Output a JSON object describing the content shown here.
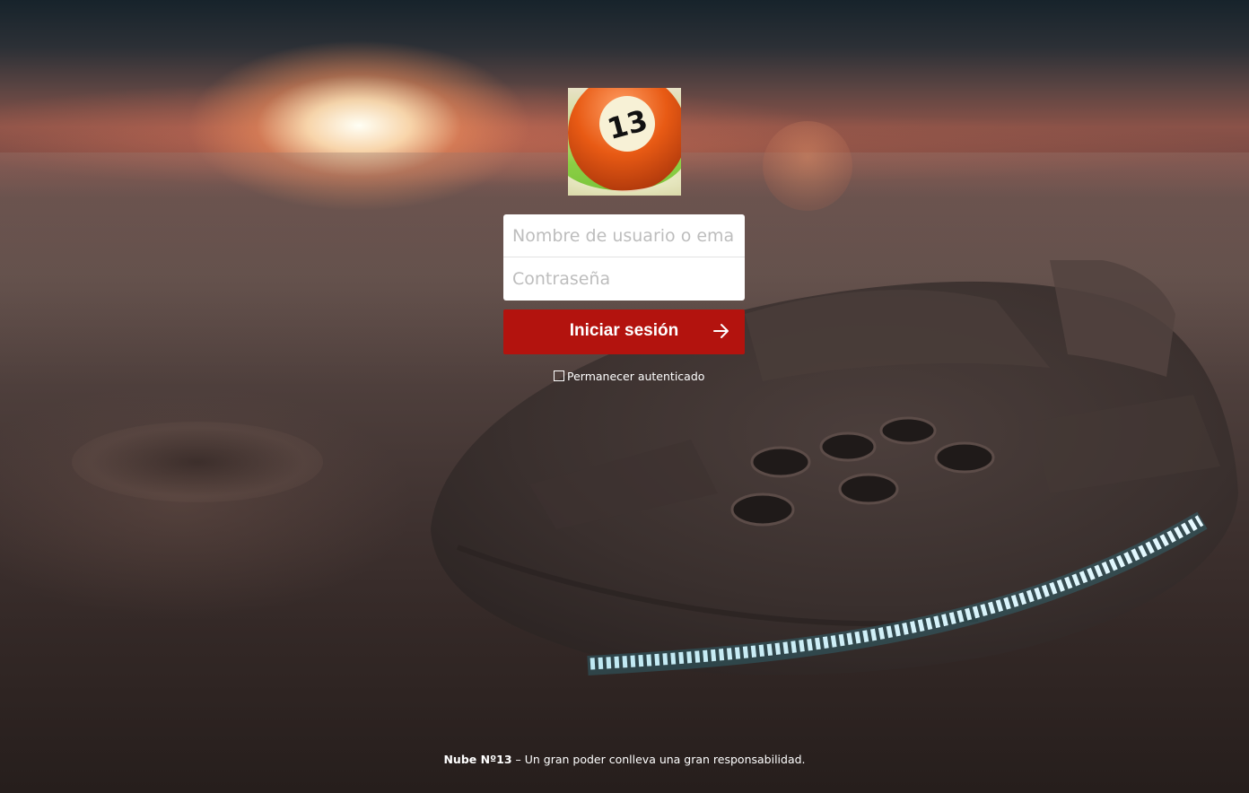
{
  "logo": {
    "number": "13",
    "icon": "billiard-ball-13-icon"
  },
  "login": {
    "user_placeholder": "Nombre de usuario o email",
    "password_placeholder": "Contraseña",
    "submit_label": "Iniciar sesión",
    "submit_icon": "arrow-right-icon",
    "remember_label": "Permanecer autenticado",
    "remember_checked": false
  },
  "footer": {
    "brand": "Nube Nº13",
    "separator": " – ",
    "tagline": "Un gran poder conlleva una gran responsabilidad."
  },
  "colors": {
    "submit_button": "#b3130e",
    "ball_orange": "#e85a14",
    "logo_green": "#78c43a"
  }
}
